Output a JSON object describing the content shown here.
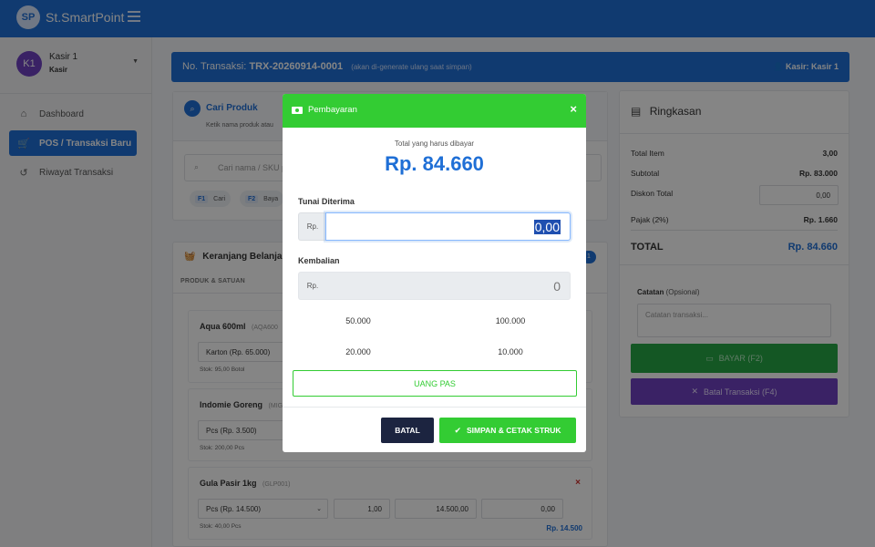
{
  "brand": {
    "name": "St.SmartPoint",
    "logo_glyph": "SP"
  },
  "user": {
    "initials": "K1",
    "name": "Kasir 1",
    "role": "Kasir"
  },
  "nav": [
    {
      "label": "Dashboard",
      "icon": "home-icon"
    },
    {
      "label": "POS / Transaksi Baru",
      "icon": "cart-icon",
      "active": true
    },
    {
      "label": "Riwayat Transaksi",
      "icon": "history-icon"
    }
  ],
  "transaction": {
    "label": "No. Transaksi:",
    "number": "TRX-20260914-0001",
    "note": "(akan di-generate ulang saat simpan)",
    "cashier_label": "Kasir: Kasir 1"
  },
  "search": {
    "title": "Cari Produk",
    "subtitle": "Ketik nama produk atau",
    "placeholder": "Cari nama / SKU p",
    "shortcuts": [
      {
        "key": "F1",
        "label": "Cari"
      },
      {
        "key": "F2",
        "label": "Baya"
      }
    ]
  },
  "cart": {
    "title": "Keranjang Belanja",
    "badge": "1",
    "column_header": "PRODUK & SATUAN",
    "items": [
      {
        "name": "Aqua 600ml",
        "code": "(AQA600",
        "unit": "Karton (Rp. 65.000)",
        "stock": "Stok: 95,00 Botol"
      },
      {
        "name": "Indomie Goreng",
        "code": "(MIG",
        "unit": "Pcs (Rp. 3.500)",
        "stock": "Stok: 200,00 Pcs"
      },
      {
        "name": "Gula Pasir 1kg",
        "code": "(GLP001)",
        "unit": "Pcs (Rp. 14.500)",
        "qty": "1,00",
        "price": "14.500,00",
        "discount": "0,00",
        "stock": "Stok: 40,00 Pcs",
        "subtotal": "Rp. 14.500",
        "remove": "×"
      }
    ]
  },
  "summary": {
    "title": "Ringkasan",
    "rows": [
      {
        "label": "Total Item",
        "value": "3,00"
      },
      {
        "label": "Subtotal",
        "value": "Rp. 83.000"
      },
      {
        "label": "Diskon Total",
        "value": ""
      },
      {
        "label": "Pajak (2%)",
        "value": "Rp. 1.660"
      }
    ],
    "discount_value": "0,00",
    "total_label": "TOTAL",
    "total_value": "Rp. 84.660",
    "note_label": "Catatan",
    "note_optional": "(Opsional)",
    "note_placeholder": "Catatan transaksi...",
    "pay_button": "BAYAR (F2)",
    "cancel_button": "Batal Transaksi (F4)"
  },
  "modal": {
    "title": "Pembayaran",
    "close": "×",
    "due_label": "Total yang harus dibayar",
    "due_amount": "Rp. 84.660",
    "cash_label": "Tunai Diterima",
    "currency": "Rp.",
    "cash_value": "0,00",
    "change_label": "Kembalian",
    "change_value": "0",
    "quick_amounts": [
      "50.000",
      "100.000",
      "20.000",
      "10.000"
    ],
    "exact_button": "UANG PAS",
    "cancel_button": "BATAL",
    "save_button": "SIMPAN & CETAK STRUK"
  },
  "colors": {
    "primary": "#1f6fd6",
    "success": "#33cc33",
    "purple": "#6f42c1",
    "danger": "#d0312d"
  }
}
